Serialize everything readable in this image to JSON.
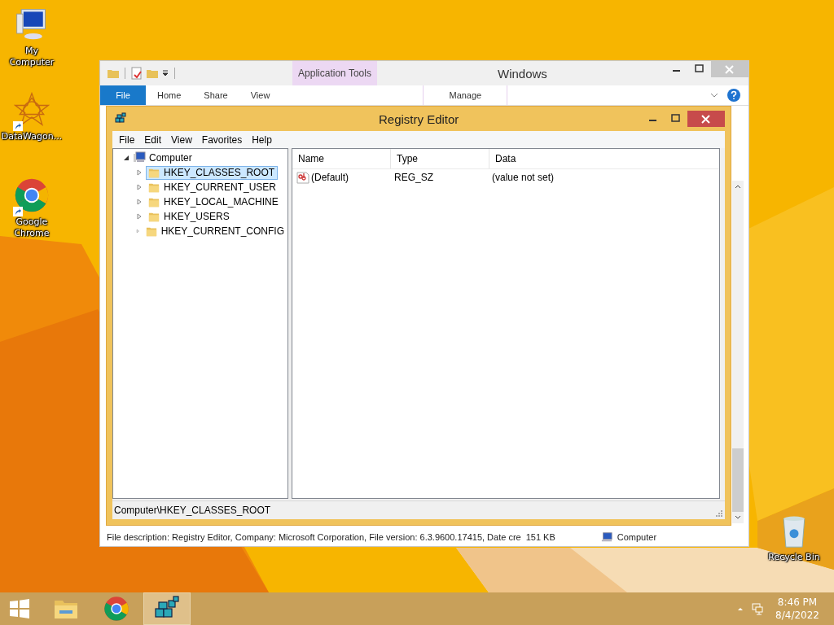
{
  "desktop_icons": [
    {
      "label": "My Computer",
      "kind": "computer",
      "shortcut": false
    },
    {
      "label": "DataWagon...",
      "kind": "star",
      "shortcut": true
    },
    {
      "label": "Google Chrome",
      "kind": "chrome",
      "shortcut": true
    }
  ],
  "recycle_bin": {
    "label": "Recycle Bin"
  },
  "explorer": {
    "title": "Windows",
    "contextual_group": "Application Tools",
    "ribbon_tabs": [
      {
        "label": "File",
        "kind": "file",
        "selected": false
      },
      {
        "label": "Home",
        "kind": "tab",
        "selected": false
      },
      {
        "label": "Share",
        "kind": "tab",
        "selected": false
      },
      {
        "label": "View",
        "kind": "tab",
        "selected": false
      },
      {
        "label": "Manage",
        "kind": "contextual",
        "selected": false
      }
    ],
    "status_text": "File description: Registry Editor, Company: Microsoft Corporation, File version: 6.3.9600.17415, Date cre",
    "status_size": "151 KB",
    "status_location": "Computer"
  },
  "regedit": {
    "title": "Registry Editor",
    "menu": [
      "File",
      "Edit",
      "View",
      "Favorites",
      "Help"
    ],
    "tree": {
      "label": "Computer",
      "expanded": true,
      "children": [
        {
          "label": "HKEY_CLASSES_ROOT",
          "expanded": false,
          "selected": true
        },
        {
          "label": "HKEY_CURRENT_USER",
          "expanded": false,
          "selected": false
        },
        {
          "label": "HKEY_LOCAL_MACHINE",
          "expanded": false,
          "selected": false
        },
        {
          "label": "HKEY_USERS",
          "expanded": false,
          "selected": false
        },
        {
          "label": "HKEY_CURRENT_CONFIG",
          "expanded": false,
          "selected": false
        }
      ]
    },
    "columns": [
      "Name",
      "Type",
      "Data"
    ],
    "rows": [
      {
        "name": "(Default)",
        "type": "REG_SZ",
        "data": "(value not set)"
      }
    ],
    "status": "Computer\\HKEY_CLASSES_ROOT"
  },
  "taskbar": {
    "apps": [
      {
        "kind": "explorer",
        "active": false
      },
      {
        "kind": "chrome",
        "active": false
      },
      {
        "kind": "regedit",
        "active": true
      }
    ],
    "time": "8:46 PM",
    "date": "8/4/2022"
  }
}
